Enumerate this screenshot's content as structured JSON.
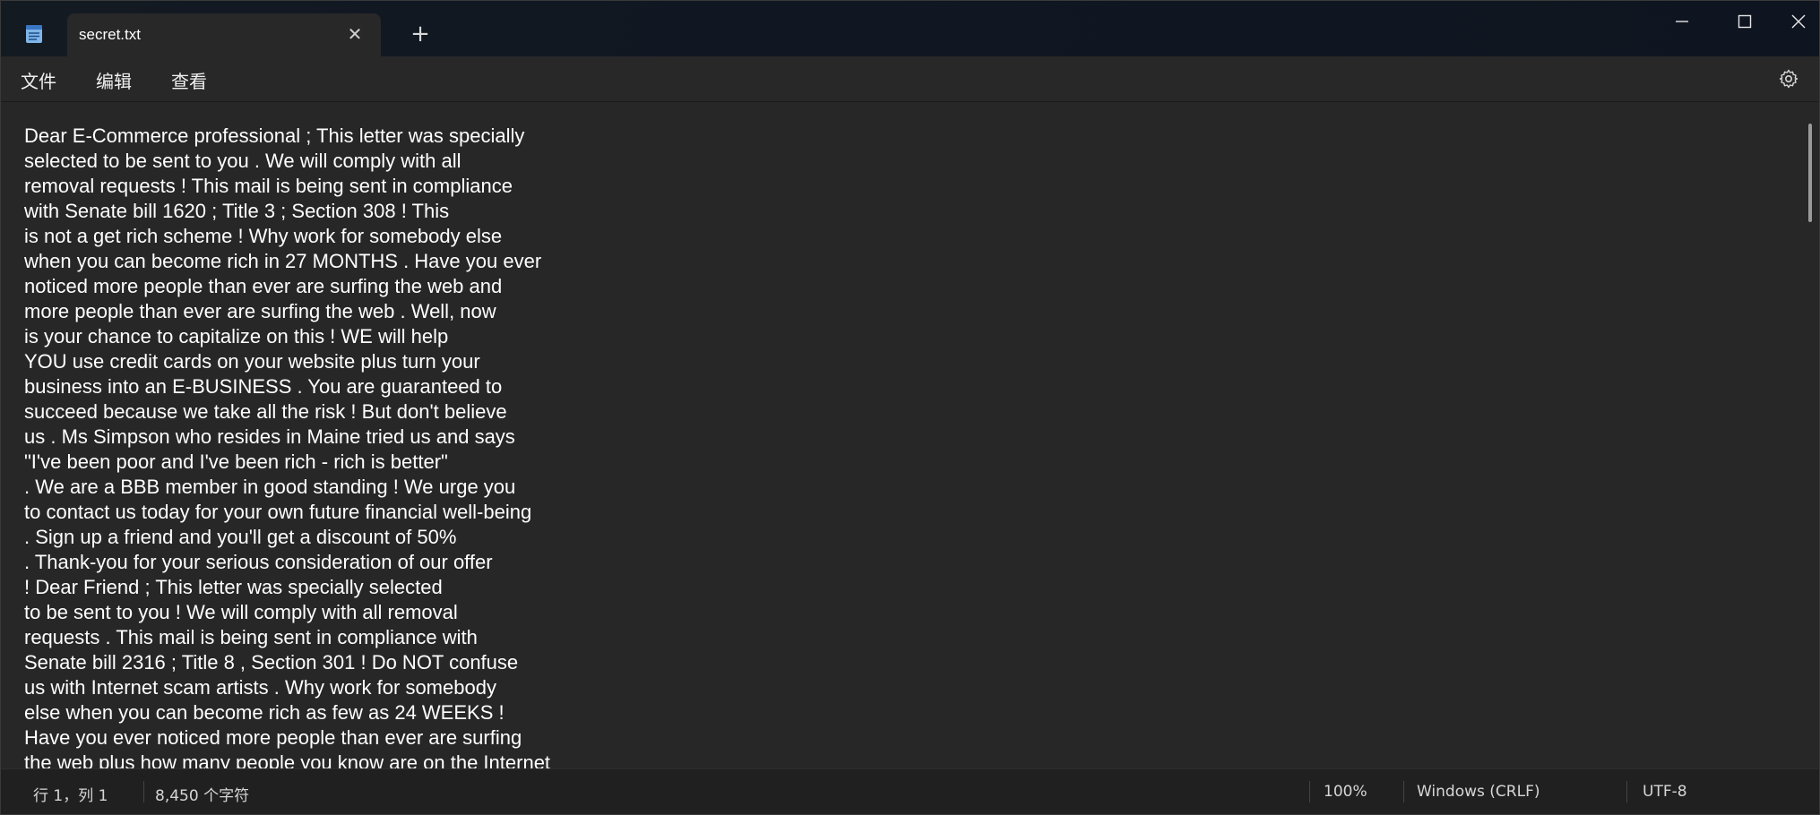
{
  "window": {
    "tab_title": "secret.txt",
    "new_tab_symbol": "+",
    "close_tab_symbol": "✕"
  },
  "menu": {
    "file": "文件",
    "edit": "编辑",
    "view": "查看"
  },
  "editor": {
    "lines": [
      "Dear E-Commerce professional ; This letter was specially",
      "selected to be sent to you . We will comply with all",
      "removal requests ! This mail is being sent in compliance",
      "with Senate bill 1620 ; Title 3 ; Section 308 ! This",
      "is not a get rich scheme ! Why work for somebody else",
      "when you can become rich in 27 MONTHS . Have you ever",
      "noticed more people than ever are surfing the web and",
      "more people than ever are surfing the web . Well, now",
      "is your chance to capitalize on this ! WE will help",
      "YOU use credit cards on your website plus turn your",
      "business into an E-BUSINESS . You are guaranteed to",
      "succeed because we take all the risk ! But don't believe",
      "us . Ms Simpson who resides in Maine tried us and says",
      "\"I've been poor and I've been rich - rich is better\"",
      ". We are a BBB member in good standing ! We urge you",
      "to contact us today for your own future financial well-being",
      ". Sign up a friend and you'll get a discount of 50%",
      ". Thank-you for your serious consideration of our offer",
      "! Dear Friend ; This letter was specially selected",
      "to be sent to you ! We will comply with all removal",
      "requests . This mail is being sent in compliance with",
      "Senate bill 2316 ; Title 8 , Section 301 ! Do NOT confuse",
      "us with Internet scam artists . Why work for somebody",
      "else when you can become rich as few as 24 WEEKS !",
      "Have you ever noticed more people than ever are surfing",
      "the web plus how many people you know are on the Internet"
    ]
  },
  "status": {
    "position": "行 1，列 1",
    "char_count": "8,450 个字符",
    "zoom": "100%",
    "line_ending": "Windows (CRLF)",
    "encoding": "UTF-8"
  }
}
